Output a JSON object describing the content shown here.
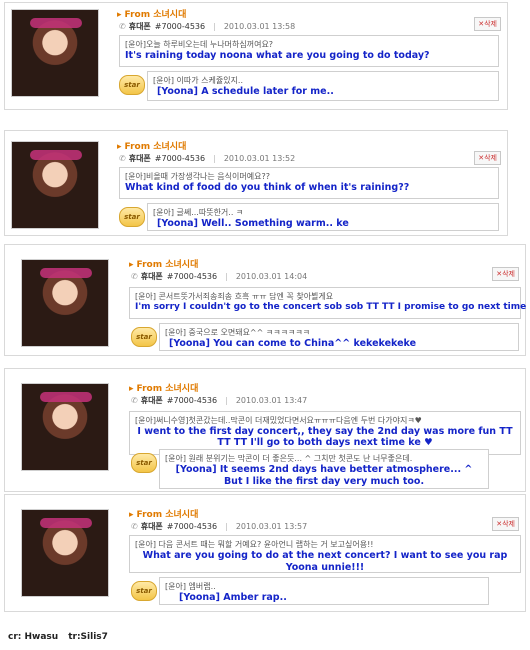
{
  "from_label": "From 소녀시대",
  "phone_label": "휴대폰",
  "delete_label": "삭제",
  "star_label": "star",
  "credits": {
    "source": "cr: Hwasu",
    "translator": "tr:Silis7"
  },
  "messages": [
    {
      "number": "#7000-4536",
      "datetime": "2010.03.01 13:58",
      "fan_kr": "[윤아]오늘 하루비오는데 누나머하심꺼여요?",
      "fan_en": "It's raining today noona what are you going to do today?",
      "reply_kr": "[윤아] 이따가 스케쥴있지..",
      "reply_en": "[Yoona] A schedule later for me.."
    },
    {
      "number": "#7000-4536",
      "datetime": "2010.03.01 13:52",
      "fan_kr": "[윤아]비올때 가장생각나는 음식이머예요??",
      "fan_en": "What kind of food do you think of when it's raining??",
      "reply_kr": "[윤아] 글쎄...따뜻한거.. ㅋ",
      "reply_en": "[Yoona] Well.. Something warm.. ke"
    },
    {
      "number": "#7000-4536",
      "datetime": "2010.03.01 14:04",
      "fan_kr": "[윤아] 콘서트뜻가서죄송죄송 흐흑 ㅠㅠ 담엔 꼭 찾아뵐게요",
      "fan_en": "I'm sorry I couldn't go to the concert sob sob TT TT I promise to go next time",
      "reply_kr": "[윤아] 중국으로 오면돼요^^ ㅋㅋㅋㅋㅋㅋ",
      "reply_en": "[Yoona] You can come to China^^ kekekekeke"
    },
    {
      "number": "#7000-4536",
      "datetime": "2010.03.01 13:47",
      "fan_kr": "[윤아]써니수영]첫콘갔는데..막콘이 더재밌었다면서요ㅠㅠㅠ다음엔 두번 다가야지ㅋ♥",
      "fan_en": "I went to the first day concert,, they say the 2nd day was more fun TT TT TT I'll go to both days next time ke ♥",
      "reply_kr": "[윤아] 원래 분위기는 막콘이 더 좋은듯... ^ 그치만 첫콘도 난 너무좋은데.",
      "reply_en": "[Yoona] It seems 2nd days have better atmosphere... ^ But I like the first day very much too."
    },
    {
      "number": "#7000-4536",
      "datetime": "2010.03.01 13:57",
      "fan_kr": "[윤아] 다음 콘서트 때는 뭐할 거예요? 윤아언니 랩하는 거 보고싶어용!!",
      "fan_en": "What are you going to do at the next concert? I want to see you rap Yoona unnie!!!",
      "reply_kr": "[윤아] 엠버랩..",
      "reply_en": "[Yoona] Amber rap.."
    }
  ]
}
